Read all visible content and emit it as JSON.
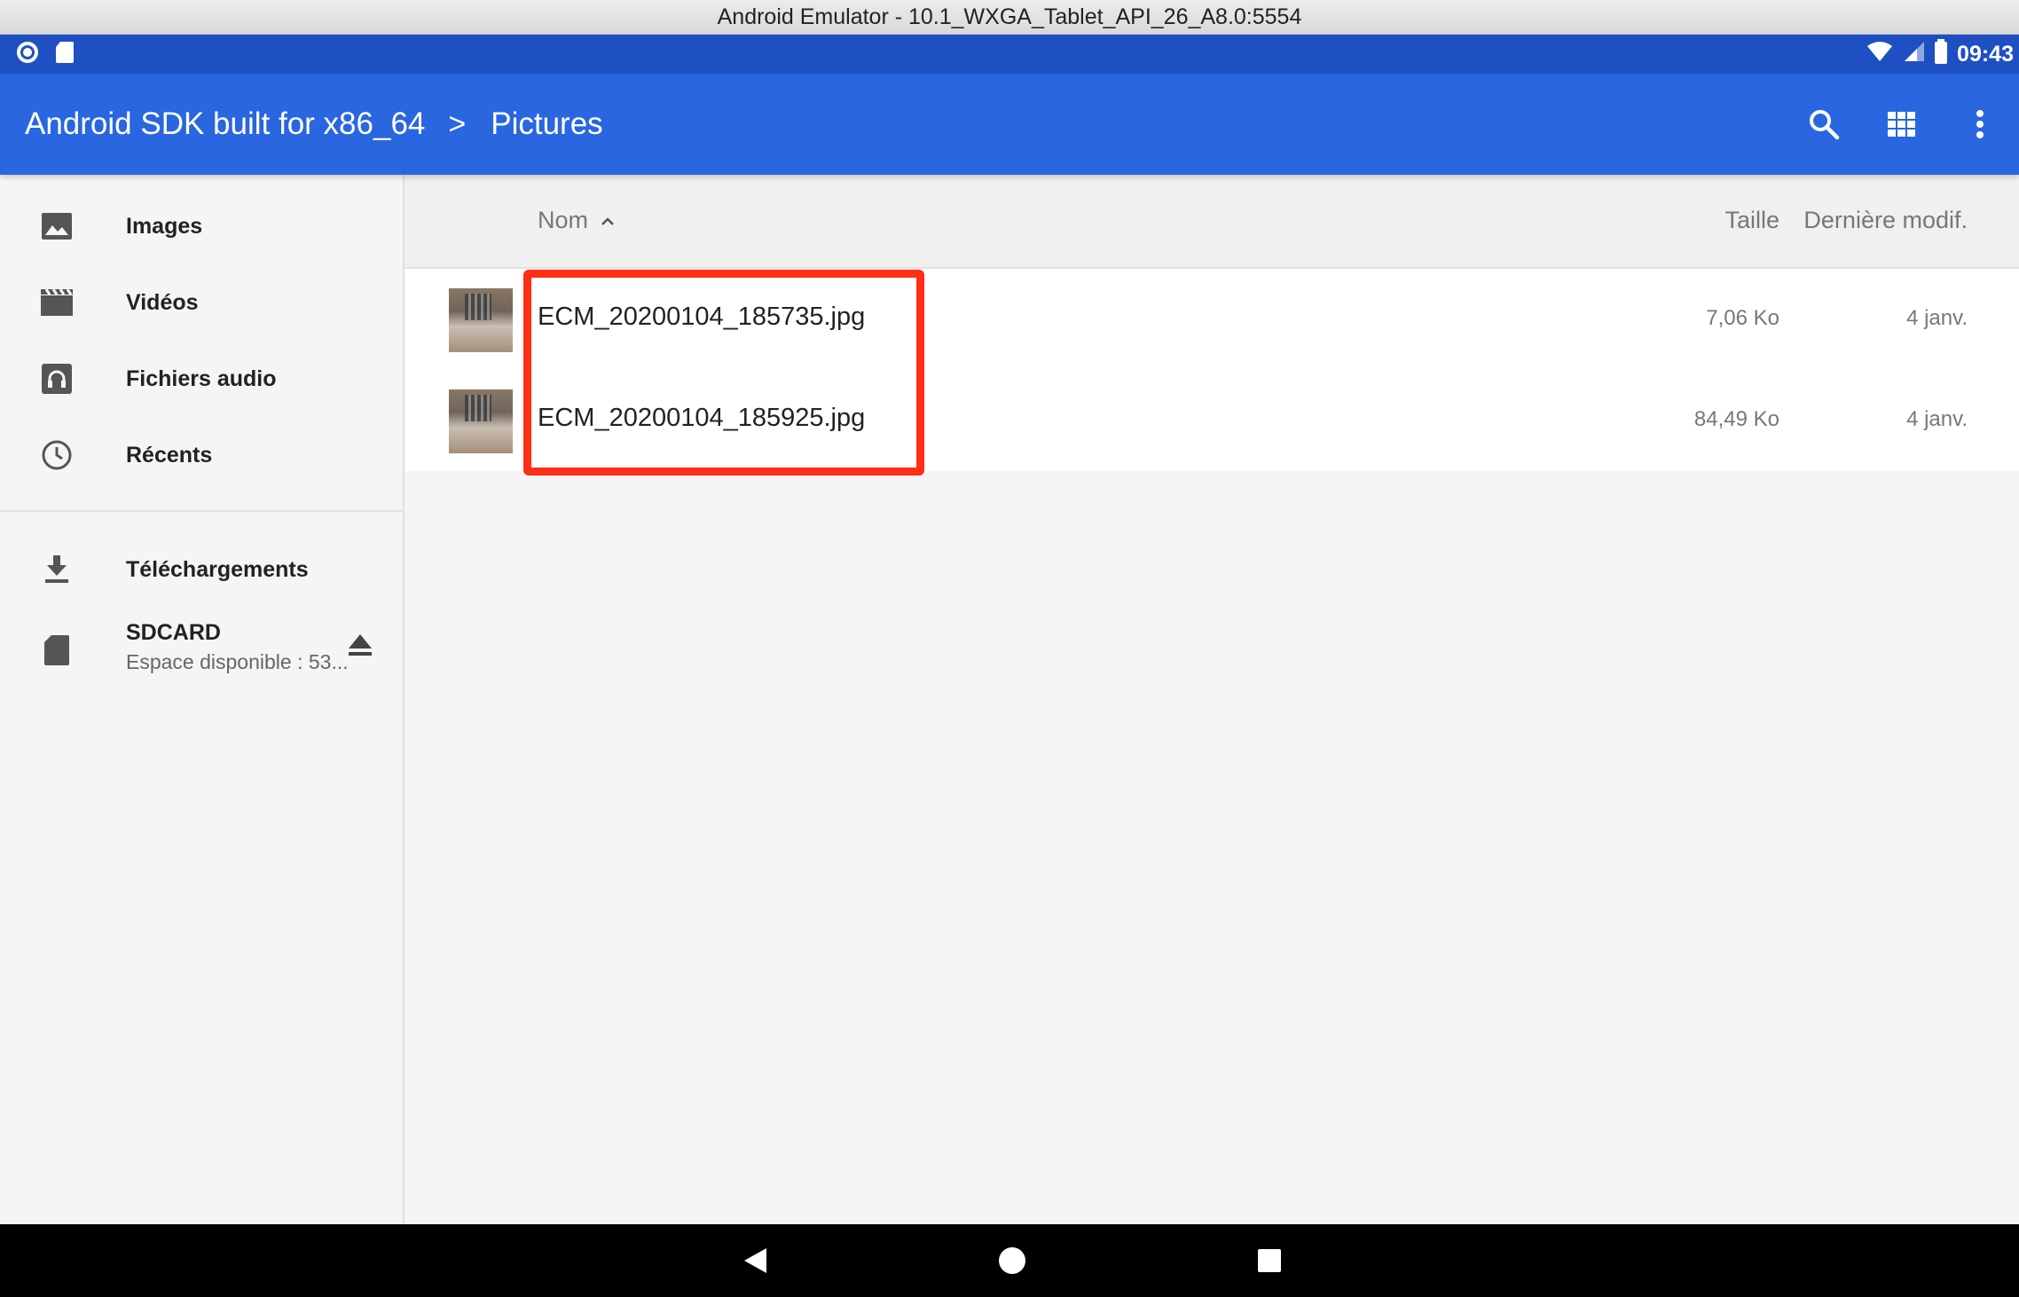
{
  "window": {
    "title": "Android Emulator - 10.1_WXGA_Tablet_API_26_A8.0:5554"
  },
  "status_bar": {
    "time": "09:43",
    "icons": [
      "record-icon",
      "sd-card-icon",
      "wifi-icon",
      "signal-icon",
      "battery-icon"
    ]
  },
  "appbar": {
    "breadcrumb_root": "Android SDK built for x86_64",
    "breadcrumb_separator": ">",
    "breadcrumb_current": "Pictures",
    "actions": [
      "search-icon",
      "grid-view-icon",
      "more-vert-icon"
    ],
    "color": "#2966e0"
  },
  "sidebar": {
    "items": [
      {
        "label": "Images",
        "icon": "image-icon"
      },
      {
        "label": "Vidéos",
        "icon": "video-icon"
      },
      {
        "label": "Fichiers audio",
        "icon": "headphones-icon"
      },
      {
        "label": "Récents",
        "icon": "clock-icon"
      },
      {
        "label": "Téléchargements",
        "icon": "download-icon"
      },
      {
        "label": "SDCARD",
        "sublabel": "Espace disponible : 53...",
        "icon": "sd-card-icon",
        "action_icon": "eject-icon"
      }
    ]
  },
  "list": {
    "columns": {
      "name": "Nom",
      "size": "Taille",
      "modified": "Dernière modif."
    },
    "sort_indicator": "ascending",
    "rows": [
      {
        "name": "ECM_20200104_185735.jpg",
        "size": "7,06 Ko",
        "modified": "4 janv."
      },
      {
        "name": "ECM_20200104_185925.jpg",
        "size": "84,49 Ko",
        "modified": "4 janv."
      }
    ]
  },
  "highlight": {
    "color": "#ff2e17"
  },
  "navbar": {
    "buttons": [
      "back-icon",
      "home-icon",
      "recents-icon"
    ]
  }
}
